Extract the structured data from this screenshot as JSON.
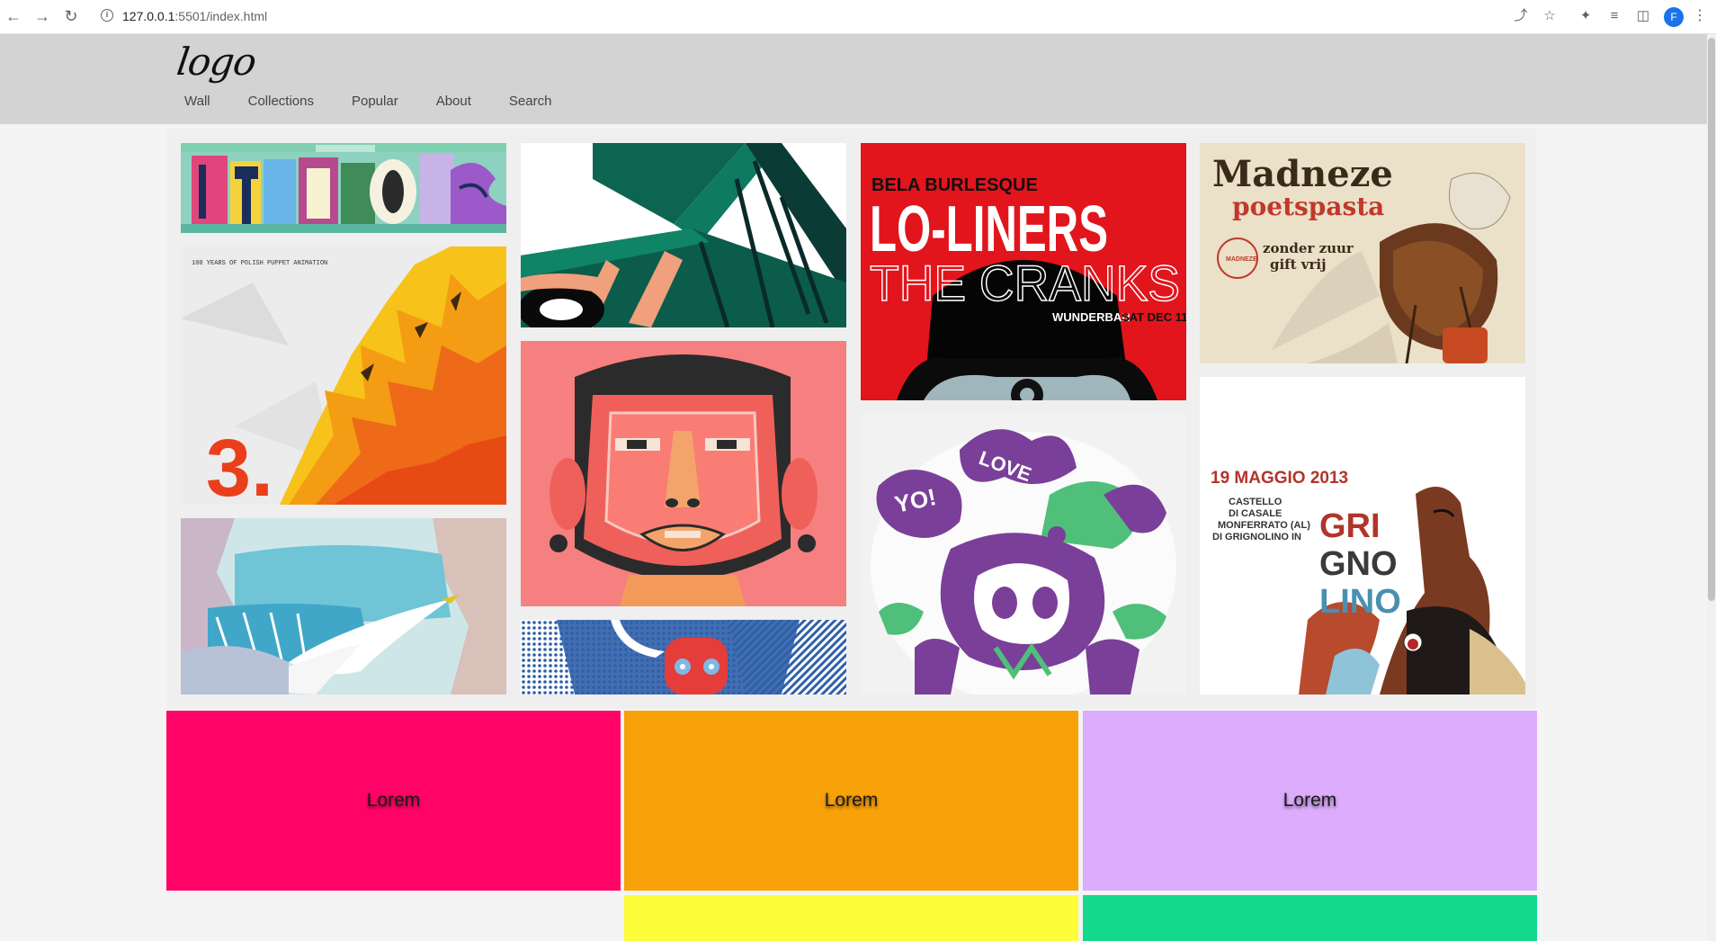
{
  "browser": {
    "url_host": "127.0.0.1",
    "url_rest": ":5501/index.html",
    "profile_initial": "F"
  },
  "header": {
    "logo": "logo",
    "menu": [
      {
        "label": "Wall"
      },
      {
        "label": "Collections"
      },
      {
        "label": "Popular"
      },
      {
        "label": "About"
      },
      {
        "label": "Search"
      }
    ],
    "background": "#d3d3d3"
  },
  "gallery": {
    "posters": [
      {
        "name": "jhb-typography-poster"
      },
      {
        "name": "polish-puppet-animation-poster",
        "top_text": "100 YEARS OF POLISH PUPPET ANIMATION",
        "number": "3."
      },
      {
        "name": "moebius-landscape-poster"
      },
      {
        "name": "biplane-illustration-poster"
      },
      {
        "name": "pink-face-illustration-poster"
      },
      {
        "name": "halftone-character-poster"
      },
      {
        "name": "lo-liners-poster",
        "line1": "BELA BURLESQUE",
        "line2": "LO-LINERS",
        "line3": "THE CRANKS",
        "line4": "WUNDERBAR",
        "line5": "SAT DEC 11"
      },
      {
        "name": "graffiti-skull-poster",
        "tag1": "YO!",
        "tag2": "LOVE"
      },
      {
        "name": "madneze-poster",
        "title": "Madneze",
        "subtitle": "poetspasta",
        "text1": "zonder zuur",
        "text2": "gift vrij",
        "stamp": "MADNEZE"
      },
      {
        "name": "grignolino-poster",
        "date": "19 MAGGIO 2013",
        "place1": "CASTELLO",
        "place2": "DI CASALE",
        "place3": "MONFERRATO (AL)",
        "place4": "DI GRIGNOLINO IN",
        "w1": "GRI",
        "w2": "GNO",
        "w3": "LINO"
      }
    ]
  },
  "cards": [
    {
      "label": "Lorem",
      "color": "#ff0466"
    },
    {
      "label": "Lorem",
      "color": "#f8a109"
    },
    {
      "label": "Lorem",
      "color": "#dcacfd"
    },
    {
      "label": "",
      "color": "#fdfd3a"
    },
    {
      "label": "",
      "color": "#14d98c"
    }
  ]
}
